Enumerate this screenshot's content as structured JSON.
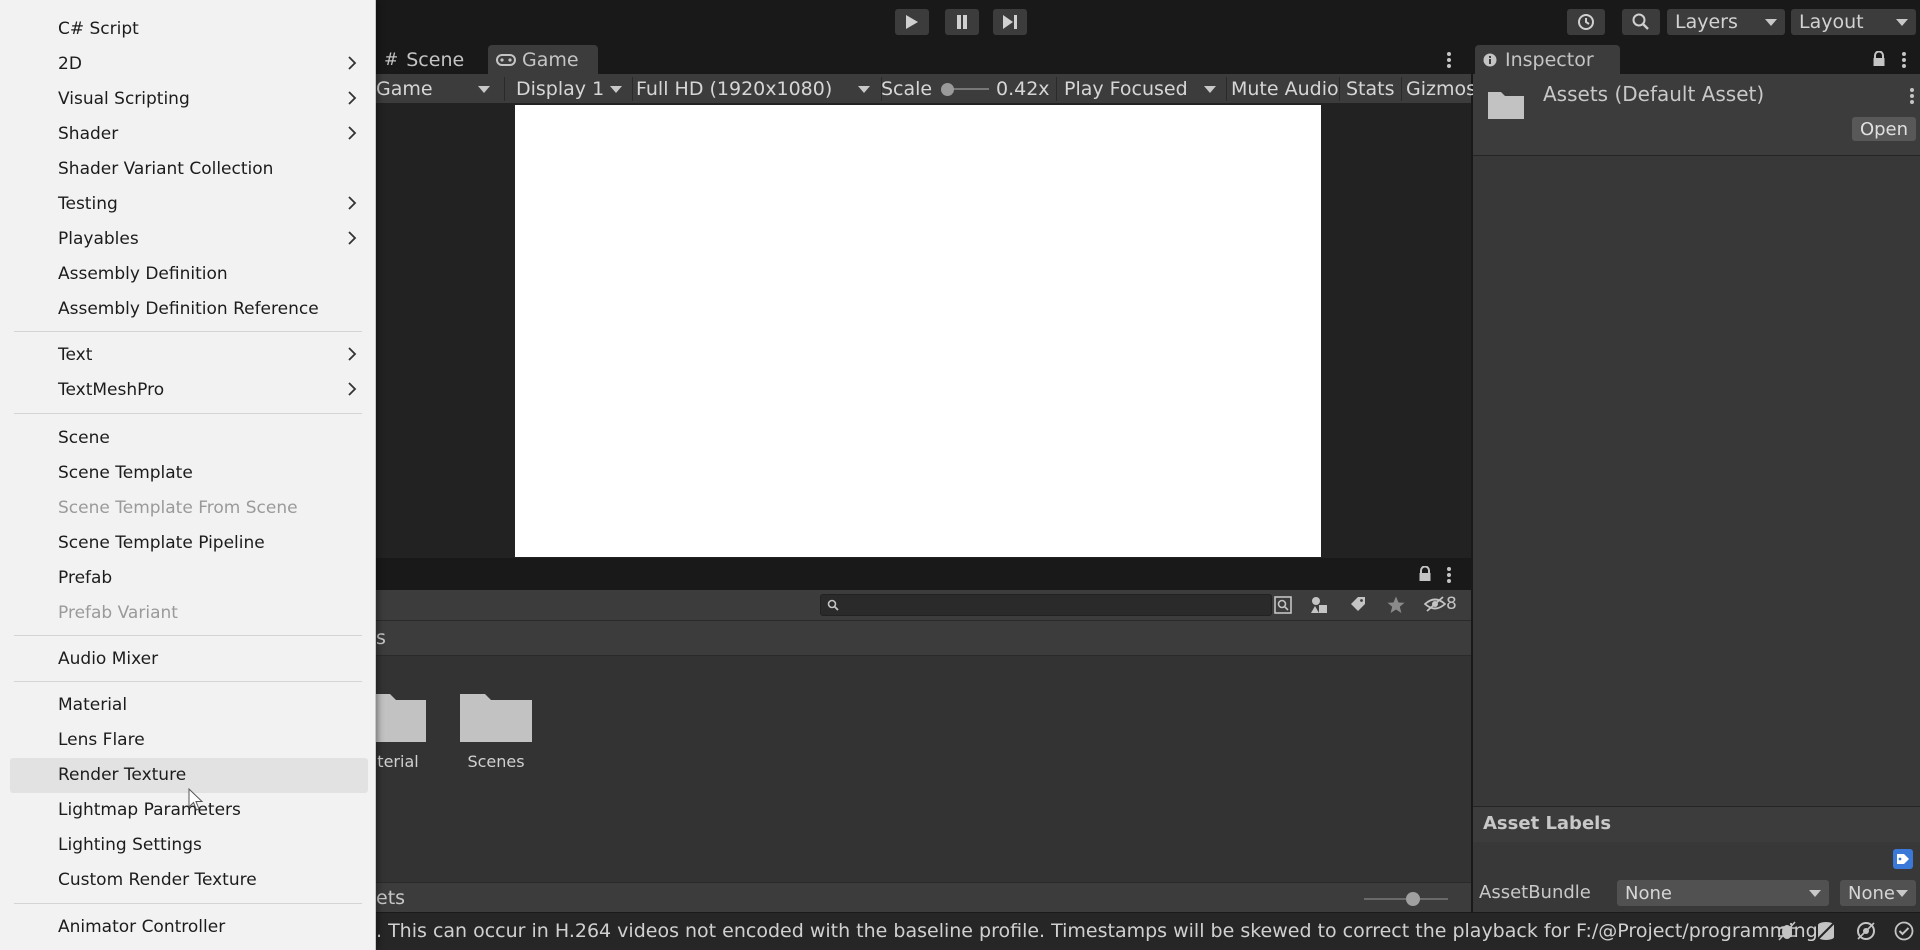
{
  "toolbar": {
    "layers_label": "Layers",
    "layout_label": "Layout"
  },
  "game_panel": {
    "tabs": [
      {
        "label": "Scene",
        "icon": "grid-icon"
      },
      {
        "label": "Game",
        "icon": "gamepad-icon"
      }
    ],
    "controls": {
      "game_mode": "Game",
      "display": "Display 1",
      "resolution": "Full HD (1920x1080)",
      "scale_label": "Scale",
      "scale_value": "0.42x",
      "play_mode": "Play Focused",
      "mute_audio": "Mute Audio",
      "stats": "Stats",
      "gizmos": "Gizmos"
    }
  },
  "inspector": {
    "tab_label": "Inspector",
    "asset_title": "Assets (Default Asset)",
    "open_button": "Open",
    "asset_labels_heading": "Asset Labels",
    "asset_bundle_label": "AssetBundle",
    "asset_bundle_value": "None",
    "asset_bundle_variant": "None"
  },
  "project_panel": {
    "hidden_count": "8",
    "breadcrumb": "s",
    "folders": [
      {
        "label": "terial"
      },
      {
        "label": "Scenes"
      }
    ],
    "footer_path": "ets"
  },
  "status_bar": {
    "message": ". This can occur in H.264 videos not encoded with the baseline profile. Timestamps will be skewed to correct the playback for F:/@Project/programming/"
  },
  "context_menu": {
    "items": [
      {
        "label": "C# Script",
        "submenu": false,
        "disabled": false
      },
      {
        "label": "2D",
        "submenu": true,
        "disabled": false
      },
      {
        "label": "Visual Scripting",
        "submenu": true,
        "disabled": false
      },
      {
        "label": "Shader",
        "submenu": true,
        "disabled": false
      },
      {
        "label": "Shader Variant Collection",
        "submenu": false,
        "disabled": false
      },
      {
        "label": "Testing",
        "submenu": true,
        "disabled": false
      },
      {
        "label": "Playables",
        "submenu": true,
        "disabled": false
      },
      {
        "label": "Assembly Definition",
        "submenu": false,
        "disabled": false
      },
      {
        "label": "Assembly Definition Reference",
        "submenu": false,
        "disabled": false
      },
      {
        "label": "Text",
        "submenu": true,
        "disabled": false
      },
      {
        "label": "TextMeshPro",
        "submenu": true,
        "disabled": false
      },
      {
        "label": "Scene",
        "submenu": false,
        "disabled": false
      },
      {
        "label": "Scene Template",
        "submenu": false,
        "disabled": false
      },
      {
        "label": "Scene Template From Scene",
        "submenu": false,
        "disabled": true
      },
      {
        "label": "Scene Template Pipeline",
        "submenu": false,
        "disabled": false
      },
      {
        "label": "Prefab",
        "submenu": false,
        "disabled": false
      },
      {
        "label": "Prefab Variant",
        "submenu": false,
        "disabled": true
      },
      {
        "label": "Audio Mixer",
        "submenu": false,
        "disabled": false
      },
      {
        "label": "Material",
        "submenu": false,
        "disabled": false
      },
      {
        "label": "Lens Flare",
        "submenu": false,
        "disabled": false
      },
      {
        "label": "Render Texture",
        "submenu": false,
        "disabled": false,
        "highlighted": true
      },
      {
        "label": "Lightmap Parameters",
        "submenu": false,
        "disabled": false
      },
      {
        "label": "Lighting Settings",
        "submenu": false,
        "disabled": false
      },
      {
        "label": "Custom Render Texture",
        "submenu": false,
        "disabled": false
      },
      {
        "label": "Animator Controller",
        "submenu": false,
        "disabled": false
      }
    ]
  },
  "colors": {
    "editor_bg": "#191919",
    "panel_bg": "#3c3c3c",
    "menu_bg": "#f2f2f2",
    "tag_blue": "#3a79d8"
  }
}
